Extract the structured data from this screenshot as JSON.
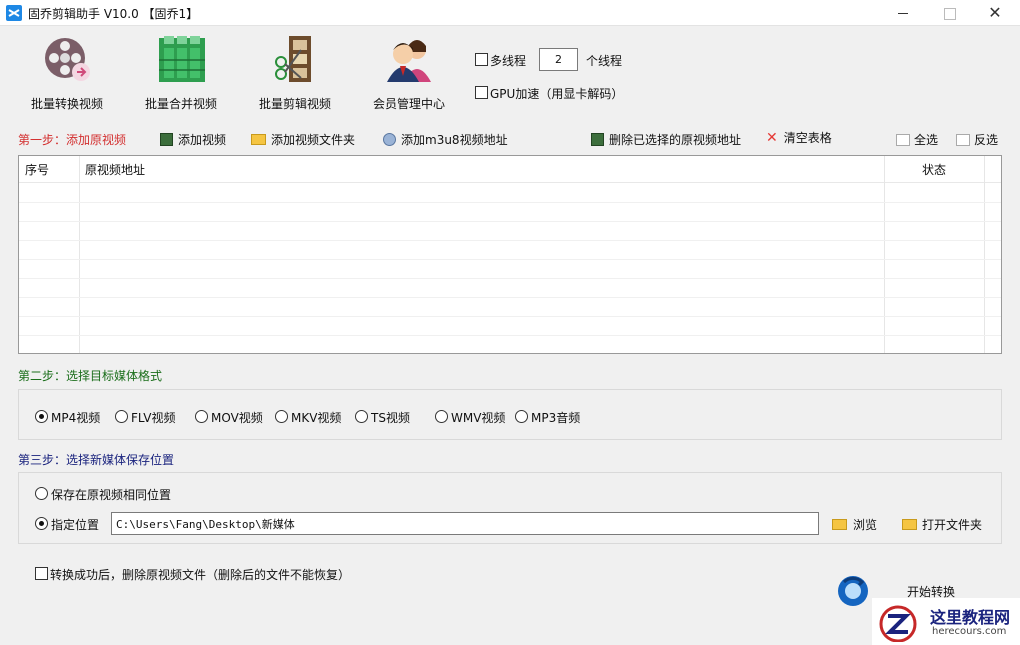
{
  "window": {
    "title": "固乔剪辑助手 V10.0   【固乔1】"
  },
  "toolbar": {
    "items": [
      {
        "label": "批量转换视频",
        "icon": "film-reel-icon"
      },
      {
        "label": "批量合并视频",
        "icon": "merge-grid-icon"
      },
      {
        "label": "批量剪辑视频",
        "icon": "film-scissors-icon"
      },
      {
        "label": "会员管理中心",
        "icon": "members-icon"
      }
    ]
  },
  "options": {
    "multithread_label": "多线程",
    "multithread_checked": false,
    "threads_value": "2",
    "threads_suffix": "个线程",
    "gpu_label": "GPU加速（用显卡解码）",
    "gpu_checked": false
  },
  "step1": {
    "title": "第一步：添加原视频",
    "add_video": "添加视频",
    "add_folder": "添加视频文件夹",
    "add_m3u8": "添加m3u8视频地址",
    "delete_selected": "删除已选择的原视频地址",
    "clear_table": "清空表格",
    "select_all": "全选",
    "invert_select": "反选"
  },
  "table": {
    "columns": [
      "序号",
      "原视频地址",
      "状态"
    ],
    "rows": []
  },
  "step2": {
    "title": "第二步：选择目标媒体格式",
    "formats": [
      "MP4视频",
      "FLV视频",
      "MOV视频",
      "MKV视频",
      "TS视频",
      "WMV视频",
      "MP3音频"
    ],
    "selected": "MP4视频"
  },
  "step3": {
    "title": "第三步：选择新媒体保存位置",
    "same_location": "保存在原视频相同位置",
    "custom_location": "指定位置",
    "path": "C:\\Users\\Fang\\Desktop\\新媒体",
    "browse": "浏览",
    "open_folder": "打开文件夹"
  },
  "footer": {
    "delete_after_label": "转换成功后，删除原视频文件（删除后的文件不能恢复）",
    "delete_after_checked": false,
    "start_label": "开始转换"
  },
  "watermark": {
    "title": "这里教程网",
    "url": "herecours.com"
  },
  "colors": {
    "step1": "#d32f2f",
    "step2": "#1b6e1b",
    "step3": "#1a237e",
    "accent": "#1e88e5"
  }
}
